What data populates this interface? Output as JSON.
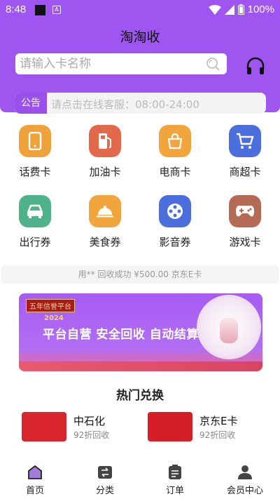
{
  "status_bar": {
    "time": "8:48",
    "battery": "100%"
  },
  "header": {
    "title": "淘淘收"
  },
  "search": {
    "placeholder": "请输入卡名称"
  },
  "notice": {
    "tag": "公告",
    "text": "请点击在线客服：08:00-24:00"
  },
  "categories": [
    {
      "label": "话费卡",
      "icon": "phone-icon",
      "color": "#f0a23a"
    },
    {
      "label": "加油卡",
      "icon": "gas-pump-icon",
      "color": "#e2694a"
    },
    {
      "label": "电商卡",
      "icon": "shopping-bag-icon",
      "color": "#f2a53c"
    },
    {
      "label": "商超卡",
      "icon": "shopping-cart-icon",
      "color": "#4a6fdc"
    },
    {
      "label": "出行券",
      "icon": "car-icon",
      "color": "#4eb38a"
    },
    {
      "label": "美食券",
      "icon": "food-cloche-icon",
      "color": "#f2a53c"
    },
    {
      "label": "影音券",
      "icon": "film-reel-icon",
      "color": "#4a6fdc"
    },
    {
      "label": "游戏卡",
      "icon": "gamepad-icon",
      "color": "#b56a55"
    }
  ],
  "ticker": {
    "text": "用** 回收成功 ¥500.00 京东E卡"
  },
  "banner": {
    "tag": "五年信誉平台",
    "year": "2024",
    "slogan": "平台自营 安全回收 自动结算"
  },
  "hot": {
    "title": "热门兑换",
    "items": [
      {
        "name": "中石化",
        "sub": "92折回收",
        "color": "#d8262c"
      },
      {
        "name": "京东E卡",
        "sub": "92折回收",
        "color": "#d61e27"
      }
    ]
  },
  "tabbar": [
    {
      "label": "首页",
      "icon": "home-icon"
    },
    {
      "label": "分类",
      "icon": "category-icon"
    },
    {
      "label": "订单",
      "icon": "order-icon"
    },
    {
      "label": "会员中心",
      "icon": "member-icon"
    }
  ],
  "colors": {
    "brand": "#9f55f0",
    "home_active": "#8a4fd6"
  }
}
